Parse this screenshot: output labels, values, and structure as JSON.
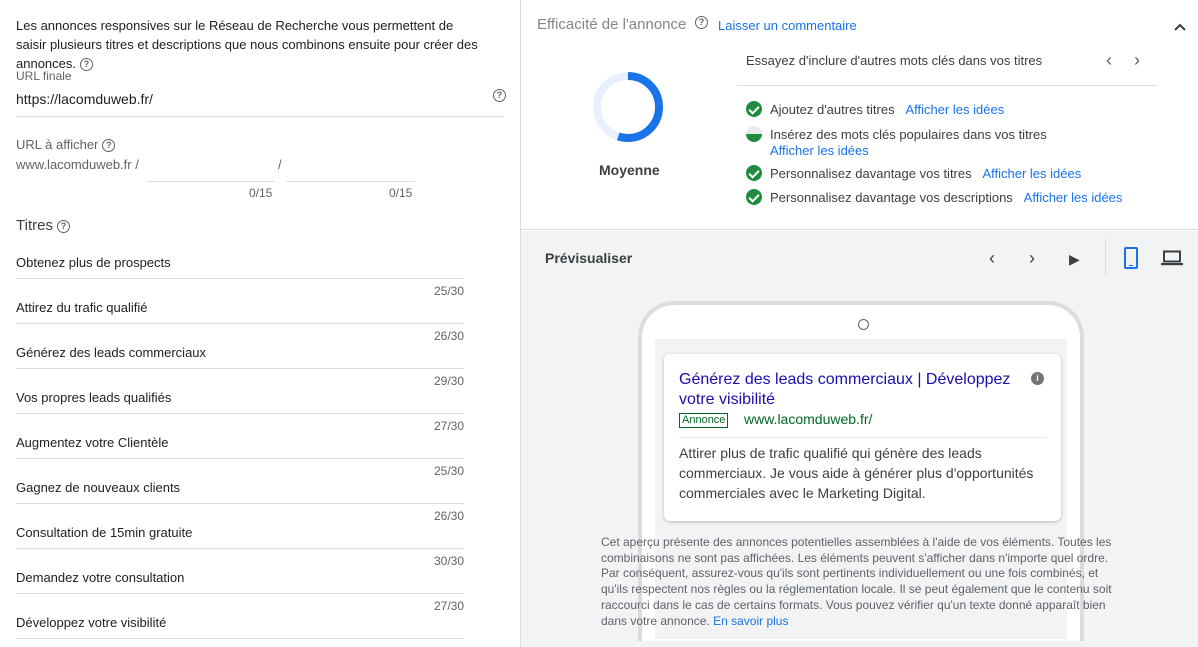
{
  "left": {
    "intro": "Les annonces responsives sur le Réseau de Recherche vous permettent de saisir plusieurs titres et descriptions que nous combinons ensuite pour créer des annonces.",
    "final_url_label": "URL finale",
    "final_url_value": "https://lacomduweb.fr/",
    "display_url_label": "URL à afficher",
    "display_url_base": "www.lacomduweb.fr /",
    "path_separator": "/",
    "path1_count": "0/15",
    "path2_count": "0/15",
    "titles_heading": "Titres",
    "titles": [
      {
        "text": "Obtenez plus de prospects",
        "count": "25/30"
      },
      {
        "text": "Attirez du trafic qualifié",
        "count": "26/30"
      },
      {
        "text": "Générez des leads commerciaux",
        "count": "29/30"
      },
      {
        "text": "Vos propres leads qualifiés",
        "count": "27/30"
      },
      {
        "text": "Augmentez votre Clientèle",
        "count": "25/30"
      },
      {
        "text": "Gagnez de nouveaux clients",
        "count": "26/30"
      },
      {
        "text": "Consultation de 15min gratuite",
        "count": "30/30"
      },
      {
        "text": "Demandez votre consultation",
        "count": "27/30"
      },
      {
        "text": "Développez votre visibilité",
        "count": ""
      }
    ]
  },
  "efficacite": {
    "title": "Efficacité de l'annonce",
    "comment_link": "Laisser un commentaire",
    "strength_label": "Moyenne",
    "strength_fraction": 0.55,
    "tip": "Essayez d'inclure d'autres mots clés dans vos titres",
    "suggestions": [
      {
        "text": "Ajoutez d'autres titres",
        "link": "Afficher les idées",
        "status": "done"
      },
      {
        "text": "Insérez des mots clés populaires dans vos titres",
        "link": "Afficher les idées",
        "status": "partial"
      },
      {
        "text": "Personnalisez davantage vos titres",
        "link": "Afficher les idées",
        "status": "done"
      },
      {
        "text": "Personnalisez davantage vos descriptions",
        "link": "Afficher les idées",
        "status": "done"
      }
    ]
  },
  "preview": {
    "title": "Prévisualiser",
    "ad": {
      "headline": "Générez des leads commerciaux | Développez votre visibilité",
      "badge": "Annonce",
      "url": "www.lacomduweb.fr/",
      "description": "Attirer plus de trafic qualifié qui génère des leads commerciaux. Je vous aide à générer plus d'opportunités commerciales avec le Marketing Digital."
    },
    "disclaimer": "Cet aperçu présente des annonces potentielles assemblées à l'aide de vos éléments. Toutes les combinaisons ne sont pas affichées. Les éléments peuvent s'afficher dans n'importe quel ordre. Par conséquent, assurez-vous qu'ils sont pertinents individuellement ou une fois combinés, et qu'ils respectent nos règles ou la réglementation locale. Il se peut également que le contenu soit raccourci dans le cas de certains formats. Vous pouvez vérifier qu'un texte donné apparaît bien dans votre annonce.",
    "learn_more": "En savoir plus"
  },
  "icons": {
    "help": "?",
    "prev": "‹",
    "next": "›",
    "play": "▶",
    "info": "i"
  },
  "colors": {
    "accent": "#1a73e8",
    "success": "#1e8e3e",
    "ad_headline": "#1a0dab",
    "ad_url": "#006621"
  }
}
